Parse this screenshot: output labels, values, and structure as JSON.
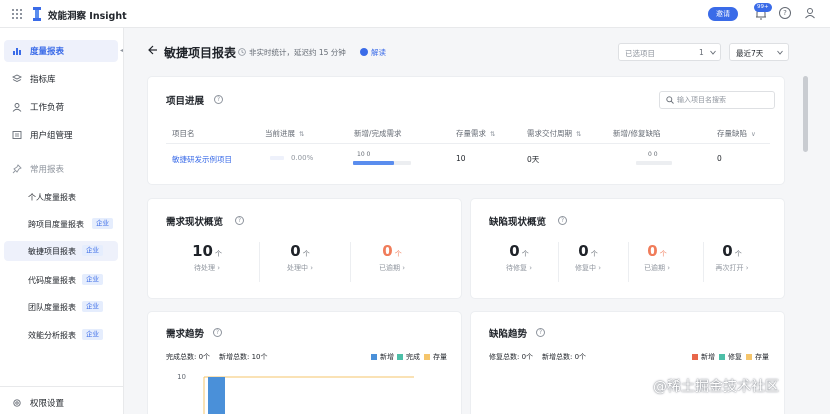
{
  "app": {
    "title": "效能洞察 Insight",
    "invite_label": "邀请",
    "notification_count": "99+",
    "help_glyph": "?"
  },
  "sidebar": {
    "items": [
      {
        "label": "度量报表",
        "icon": "bar-chart-icon",
        "active": true
      },
      {
        "label": "指标库",
        "icon": "layers-icon",
        "active": false
      },
      {
        "label": "工作负荷",
        "icon": "user-icon",
        "active": false
      },
      {
        "label": "用户组管理",
        "icon": "list-icon",
        "active": false
      }
    ],
    "common_label": "常用报表",
    "sub_items": [
      {
        "label": "个人度量报表",
        "tag": ""
      },
      {
        "label": "跨项目度量报表",
        "tag": "企业"
      },
      {
        "label": "敏捷项目报表",
        "tag": "企业",
        "active": true
      },
      {
        "label": "代码度量报表",
        "tag": "企业"
      },
      {
        "label": "团队度量报表",
        "tag": "企业"
      },
      {
        "label": "效能分析报表",
        "tag": "企业"
      }
    ],
    "settings_label": "权限设置"
  },
  "header": {
    "title": "敏捷项目报表",
    "nonrealtime_text": "非实时统计，延迟约 15 分钟",
    "explain_label": "解读",
    "project_select_placeholder": "已选项目",
    "project_select_count": "1",
    "range_select_value": "最近7天"
  },
  "progress_card": {
    "title": "项目进展",
    "search_placeholder": "输入项目名搜索",
    "columns": [
      "项目名",
      "当前进展",
      "新增/完成需求",
      "存量需求",
      "需求交付周期",
      "新增/修复缺陷",
      "存量缺陷"
    ],
    "row": {
      "name": "敏捷研发示例项目",
      "progress": "0.00%",
      "progress_value": 0,
      "req_label": "10 0",
      "req_added": 10,
      "req_done": 0,
      "stock_req": "10",
      "cycle": "0天",
      "bug_label": "0 0",
      "bug_added": 0,
      "bug_fixed": 0,
      "stock_bug": "0"
    }
  },
  "req_overview": {
    "title": "需求现状概览",
    "unit": "个",
    "stats": [
      {
        "value": "10",
        "label": "待处理 ›",
        "red": false
      },
      {
        "value": "0",
        "label": "处理中 ›",
        "red": false
      },
      {
        "value": "0",
        "label": "已逾期 ›",
        "red": true
      }
    ]
  },
  "bug_overview": {
    "title": "缺陷现状概览",
    "unit": "个",
    "stats": [
      {
        "value": "0",
        "label": "待修复 ›",
        "red": false
      },
      {
        "value": "0",
        "label": "修复中 ›",
        "red": false
      },
      {
        "value": "0",
        "label": "已逾期 ›",
        "red": true
      },
      {
        "value": "0",
        "label": "再次打开 ›",
        "red": false
      }
    ]
  },
  "req_trend": {
    "title": "需求趋势",
    "done_label": "完成总数:",
    "done_value": "0个",
    "added_label": "新增总数:",
    "added_value": "10个",
    "legend": [
      {
        "name": "新增",
        "color": "#4a90d9"
      },
      {
        "name": "完成",
        "color": "#4dbfa8"
      },
      {
        "name": "存量",
        "color": "#f5c56b"
      }
    ]
  },
  "bug_trend": {
    "title": "缺陷趋势",
    "fixed_label": "修复总数:",
    "fixed_value": "0个",
    "added_label": "新增总数:",
    "added_value": "0个",
    "legend": [
      {
        "name": "新增",
        "color": "#e8664a"
      },
      {
        "name": "修复",
        "color": "#4dbfa8"
      },
      {
        "name": "存量",
        "color": "#f5c56b"
      }
    ]
  },
  "chart_data": {
    "type": "bar",
    "categories": [
      ""
    ],
    "series": [
      {
        "name": "新增",
        "values": [
          10
        ]
      },
      {
        "name": "完成",
        "values": [
          0
        ]
      },
      {
        "name": "存量",
        "values": [
          10
        ]
      }
    ],
    "y_tick_visible": "10"
  },
  "watermark": "@稀土掘金技术社区"
}
